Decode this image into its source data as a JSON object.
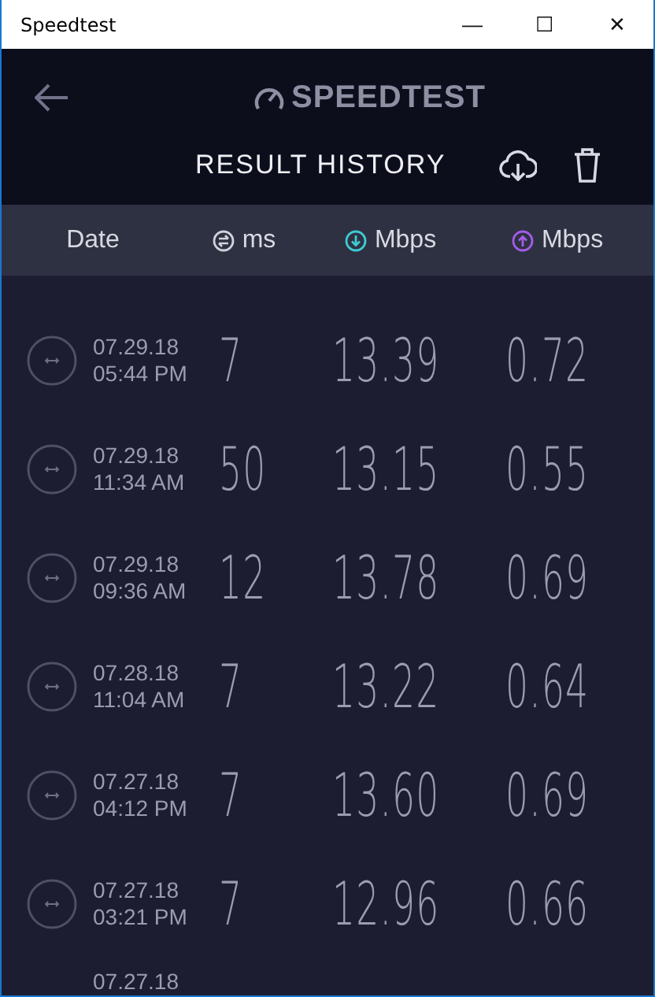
{
  "window": {
    "title": "Speedtest",
    "controls": [
      "—",
      "☐",
      "✕"
    ]
  },
  "header": {
    "logo": "SPEEDTEST",
    "title": "RESULT HISTORY"
  },
  "columns": [
    {
      "label": "Date",
      "kind": "plain"
    },
    {
      "label": "ms",
      "kind": "ping"
    },
    {
      "label": "Mbps",
      "kind": "download"
    },
    {
      "label": "Mbps",
      "kind": "upload"
    }
  ],
  "rows": [
    {
      "date": "07.29.18",
      "time": "05:44 PM",
      "ping": "7",
      "download": "13.39",
      "upload": "0.72"
    },
    {
      "date": "07.29.18",
      "time": "11:34 AM",
      "ping": "50",
      "download": "13.15",
      "upload": "0.55"
    },
    {
      "date": "07.29.18",
      "time": "09:36 AM",
      "ping": "12",
      "download": "13.78",
      "upload": "0.69"
    },
    {
      "date": "07.28.18",
      "time": "11:04 AM",
      "ping": "7",
      "download": "13.22",
      "upload": "0.64"
    },
    {
      "date": "07.27.18",
      "time": "04:12 PM",
      "ping": "7",
      "download": "13.60",
      "upload": "0.69"
    },
    {
      "date": "07.27.18",
      "time": "03:21 PM",
      "ping": "7",
      "download": "12.96",
      "upload": "0.66"
    },
    {
      "date": "07.27.18"
    }
  ]
}
